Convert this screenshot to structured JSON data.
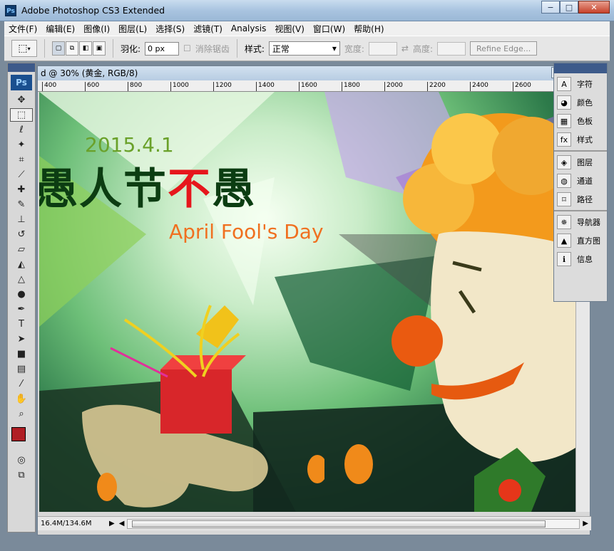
{
  "window": {
    "title": "Adobe Photoshop CS3 Extended",
    "min_label": "−",
    "max_label": "□",
    "close_label": "✕"
  },
  "menu": [
    "文件(F)",
    "编辑(E)",
    "图像(I)",
    "图层(L)",
    "选择(S)",
    "滤镜(T)",
    "Analysis",
    "视图(V)",
    "窗口(W)",
    "帮助(H)"
  ],
  "options": {
    "feather_label": "羽化:",
    "feather_value": "0 px",
    "antialias_label": "消除锯齿",
    "style_label": "样式:",
    "style_value": "正常",
    "width_label": "宽度:",
    "height_label": "高度:",
    "refine_label": "Refine Edge..."
  },
  "tools_logo": "Ps",
  "document": {
    "title": "d @ 30% (黄金, RGB/8)",
    "ruler_ticks": [
      "400",
      "600",
      "800",
      "1000",
      "1200",
      "1400",
      "1600",
      "1800",
      "2000",
      "2200",
      "2400",
      "2600"
    ],
    "status": "16.4M/134.6M"
  },
  "artwork": {
    "date": "2015.4.1",
    "headline_a": "愚人节",
    "headline_b": "不",
    "headline_c": "愚",
    "subtitle": "April Fool's Day"
  },
  "panels": {
    "group1": [
      "字符",
      "颜色",
      "色板",
      "样式"
    ],
    "group2": [
      "图层",
      "通道",
      "路径"
    ],
    "group3": [
      "导航器",
      "直方图",
      "信息"
    ]
  },
  "colors": {
    "foreground": "#b01e24",
    "background": "#ffffff",
    "accent": "#3d5a8a"
  }
}
